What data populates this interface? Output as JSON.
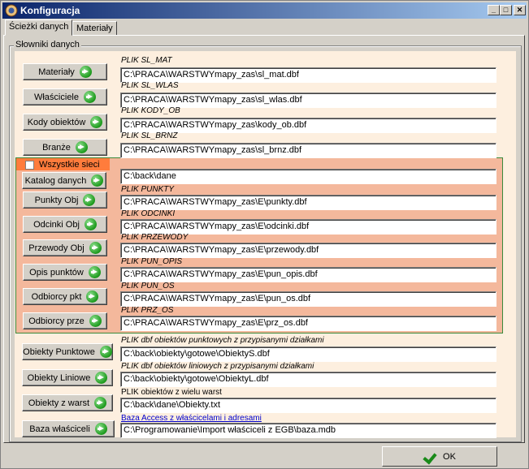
{
  "window": {
    "title": "Konfiguracja"
  },
  "titlebar_buttons": {
    "minimize": "_",
    "maximize": "□",
    "close": "✕"
  },
  "tabs": [
    {
      "label": "Ścieżki danych"
    },
    {
      "label": "Materiały"
    }
  ],
  "group": {
    "label": "Słowniki danych"
  },
  "all_networks": {
    "label": "Wszystkie sieci",
    "checked": false
  },
  "rows": [
    {
      "button": "Materiały",
      "caption": "PLIK SL_MAT",
      "value": "C:\\PRACA\\WARSTWYmapy_zas\\sl_mat.dbf"
    },
    {
      "button": "Właściciele",
      "caption": "PLIK SL_WLAS",
      "value": "C:\\PRACA\\WARSTWYmapy_zas\\sl_wlas.dbf"
    },
    {
      "button": "Kody obiektów",
      "caption": "PLIK KODY_OB",
      "value": "C:\\PRACA\\WARSTWYmapy_zas\\kody_ob.dbf"
    },
    {
      "button": "Branże",
      "caption": "PLIK SL_BRNZ",
      "value": "C:\\PRACA\\WARSTWYmapy_zas\\sl_brnz.dbf"
    },
    {
      "button": "Katalog danych",
      "caption": "",
      "value": "C:\\back\\dane"
    },
    {
      "button": "Punkty Obj",
      "caption": "PLIK PUNKTY",
      "value": "C:\\PRACA\\WARSTWYmapy_zas\\E\\punkty.dbf"
    },
    {
      "button": "Odcinki Obj",
      "caption": "PLIK ODCINKI",
      "value": "C:\\PRACA\\WARSTWYmapy_zas\\E\\odcinki.dbf"
    },
    {
      "button": "Przewody Obj",
      "caption": "PLIK PRZEWODY",
      "value": "C:\\PRACA\\WARSTWYmapy_zas\\E\\przewody.dbf"
    },
    {
      "button": "Opis punktów",
      "caption": "PLIK PUN_OPIS",
      "value": "C:\\PRACA\\WARSTWYmapy_zas\\E\\pun_opis.dbf"
    },
    {
      "button": "Odbiorcy pkt",
      "caption": "PLIK PUN_OS",
      "value": "C:\\PRACA\\WARSTWYmapy_zas\\E\\pun_os.dbf"
    },
    {
      "button": "Odbiorcy prze",
      "caption": "PLIK PRZ_OS",
      "value": "C:\\PRACA\\WARSTWYmapy_zas\\E\\prz_os.dbf"
    },
    {
      "button": "Obiekty Punktowe",
      "caption": "PLIK dbf obiektów punktowych z przypisanymi działkami",
      "value": "C:\\back\\obiekty\\gotowe\\ObiektyS.dbf"
    },
    {
      "button": "Obiekty Liniowe",
      "caption": "PLIK dbf obiektów liniowych z przypisanymi działkami",
      "value": "C:\\back\\obiekty\\gotowe\\ObiektyL.dbf"
    },
    {
      "button": "Obiekty z warst",
      "caption": "PLIK obiektów z wielu warst",
      "value": "C:\\back\\dane\\Obiekty.txt"
    },
    {
      "button": "Baza właściceli",
      "caption": "Baza Access z właścicelami i adresami",
      "value": "C:\\Programowanie\\Import właściceli z EGB\\baza.mdb"
    }
  ],
  "ok": {
    "label": "OK"
  }
}
